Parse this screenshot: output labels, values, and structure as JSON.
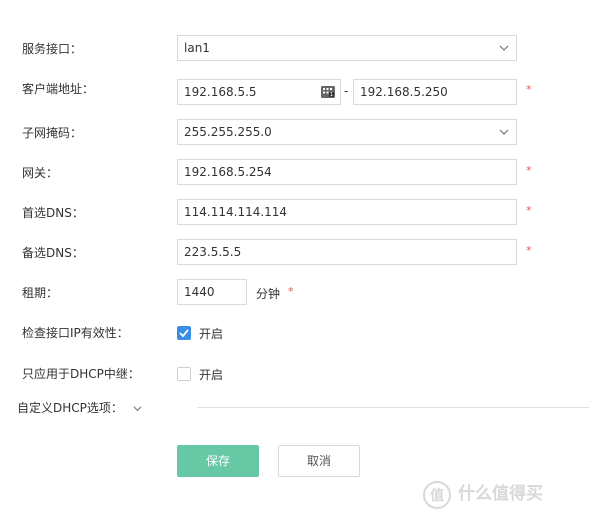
{
  "form": {
    "service_interface": {
      "label": "服务接口：",
      "value": "lan1"
    },
    "client_address": {
      "label": "客户端地址：",
      "start": "192.168.5.5",
      "separator": "-",
      "end": "192.168.5.250",
      "required": "*"
    },
    "subnet_mask": {
      "label": "子网掩码：",
      "value": "255.255.255.0"
    },
    "gateway": {
      "label": "网关：",
      "value": "192.168.5.254",
      "required": "*"
    },
    "preferred_dns": {
      "label": "首选DNS：",
      "value": "114.114.114.114",
      "required": "*"
    },
    "alternate_dns": {
      "label": "备选DNS：",
      "value": "223.5.5.5",
      "required": "*"
    },
    "lease": {
      "label": "租期：",
      "value": "1440",
      "unit": "分钟",
      "required": "*"
    },
    "check_ip_validity": {
      "label": "检查接口IP有效性：",
      "checked": true,
      "option": "开启"
    },
    "dhcp_relay_only": {
      "label": "只应用于DHCP中继：",
      "checked": false,
      "option": "开启"
    },
    "custom_dhcp_options": {
      "label": "自定义DHCP选项："
    }
  },
  "buttons": {
    "save": "保存",
    "cancel": "取消"
  },
  "watermark": {
    "text": "什么值得买"
  },
  "colors": {
    "accent": "#66c8a4",
    "checkbox": "#3a8ee6",
    "required": "#e05a5a"
  }
}
